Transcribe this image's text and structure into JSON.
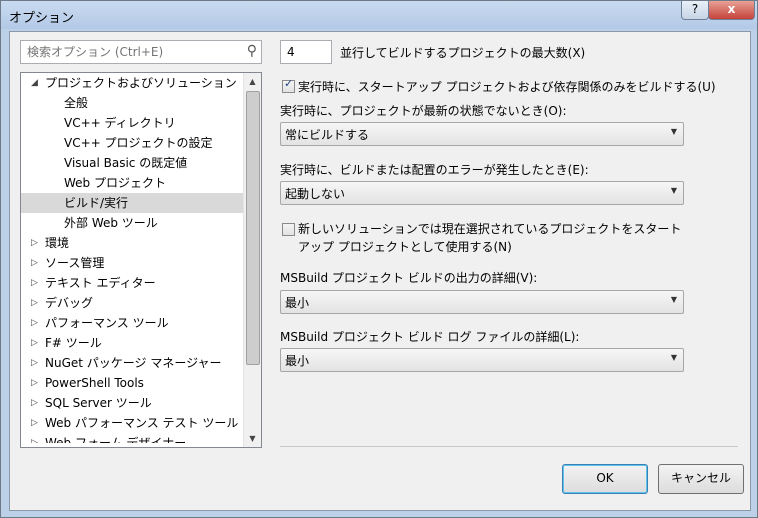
{
  "window": {
    "title": "オプション",
    "help_label": "?",
    "close_label": "x"
  },
  "search": {
    "placeholder": "検索オプション (Ctrl+E)",
    "icon": "search-icon"
  },
  "tree": {
    "items": [
      {
        "label": "プロジェクトおよびソリューション",
        "level": 0,
        "expanded": true
      },
      {
        "label": "全般",
        "level": 1
      },
      {
        "label": "VC++ ディレクトリ",
        "level": 1
      },
      {
        "label": "VC++ プロジェクトの設定",
        "level": 1
      },
      {
        "label": "Visual Basic の既定値",
        "level": 1
      },
      {
        "label": "Web プロジェクト",
        "level": 1
      },
      {
        "label": "ビルド/実行",
        "level": 1,
        "selected": true
      },
      {
        "label": "外部 Web ツール",
        "level": 1
      },
      {
        "label": "環境",
        "level": 0
      },
      {
        "label": "ソース管理",
        "level": 0
      },
      {
        "label": "テキスト エディター",
        "level": 0
      },
      {
        "label": "デバッグ",
        "level": 0
      },
      {
        "label": "パフォーマンス ツール",
        "level": 0
      },
      {
        "label": "F# ツール",
        "level": 0
      },
      {
        "label": "NuGet パッケージ マネージャー",
        "level": 0
      },
      {
        "label": "PowerShell Tools",
        "level": 0
      },
      {
        "label": "SQL Server ツール",
        "level": 0
      },
      {
        "label": "Web パフォーマンス テスト ツール",
        "level": 0
      },
      {
        "label": "Web フォーム デザイナー",
        "level": 0
      }
    ]
  },
  "settings": {
    "max_parallel": {
      "value": "4",
      "label": "並行してビルドするプロジェクトの最大数(X)"
    },
    "only_startup": {
      "checked": true,
      "label": "実行時に、スタートアップ プロジェクトおよび依存関係のみをビルドする(U)"
    },
    "out_of_date": {
      "label": "実行時に、プロジェクトが最新の状態でないとき(O):",
      "value": "常にビルドする"
    },
    "build_error": {
      "label": "実行時に、ビルドまたは配置のエラーが発生したとき(E):",
      "value": "起動しない"
    },
    "new_solution": {
      "checked": false,
      "label_line1": "新しいソリューションでは現在選択されているプロジェクトをスタート",
      "label_line2": "アップ プロジェクトとして使用する(N)"
    },
    "build_output": {
      "label": "MSBuild プロジェクト ビルドの出力の詳細(V):",
      "value": "最小"
    },
    "build_log": {
      "label": "MSBuild プロジェクト ビルド ログ ファイルの詳細(L):",
      "value": "最小"
    }
  },
  "buttons": {
    "ok": "OK",
    "cancel": "キャンセル"
  }
}
